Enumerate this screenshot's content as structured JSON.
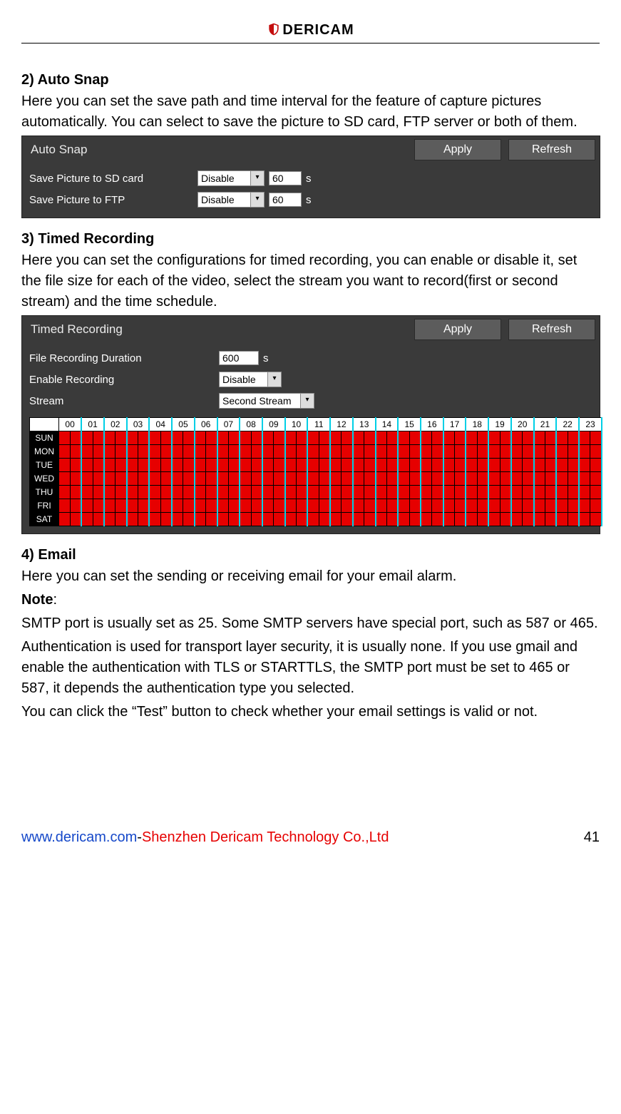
{
  "header": {
    "brand": "DERICAM"
  },
  "sections": {
    "autosnap": {
      "heading": "2) Auto Snap",
      "desc": "Here you can set the save path and time interval for the feature of capture pictures automatically. You can select to save the picture to SD card, FTP server or both of them.",
      "panel_title": "Auto Snap",
      "apply": "Apply",
      "refresh": "Refresh",
      "row1_label": "Save Picture to SD card",
      "row1_select": "Disable",
      "row1_value": "60",
      "row1_unit": "s",
      "row2_label": "Save Picture to FTP",
      "row2_select": "Disable",
      "row2_value": "60",
      "row2_unit": "s"
    },
    "timed": {
      "heading": "3) Timed Recording",
      "desc": "Here you can set the configurations for timed recording, you can enable or disable it, set the file size for each of the video, select the stream you want to record(first or second stream) and the time schedule.",
      "panel_title": "Timed Recording",
      "apply": "Apply",
      "refresh": "Refresh",
      "row1_label": "File Recording Duration",
      "row1_value": "600",
      "row1_unit": "s",
      "row2_label": "Enable Recording",
      "row2_select": "Disable",
      "row3_label": "Stream",
      "row3_select": "Second Stream",
      "hours": [
        "00",
        "01",
        "02",
        "03",
        "04",
        "05",
        "06",
        "07",
        "08",
        "09",
        "10",
        "11",
        "12",
        "13",
        "14",
        "15",
        "16",
        "17",
        "18",
        "19",
        "20",
        "21",
        "22",
        "23"
      ],
      "days": [
        "SUN",
        "MON",
        "TUE",
        "WED",
        "THU",
        "FRI",
        "SAT"
      ]
    },
    "email": {
      "heading": "4) Email",
      "p1": "Here you can set the sending or receiving email for your email alarm.",
      "note_label": "Note",
      "p2": "SMTP port is usually set as 25. Some SMTP servers have special port, such as 587 or 465.",
      "p3": "Authentication is used for transport layer security, it is usually none. If you use gmail and enable the authentication with TLS or STARTTLS, the SMTP port must be set to 465 or 587, it depends the authentication type you selected.",
      "p4": "You can click the “Test” button to check whether your email settings is valid or not."
    }
  },
  "footer": {
    "url": "www.dericam.com",
    "sep": "-",
    "company": "Shenzhen Dericam Technology Co.,Ltd",
    "page": "41"
  }
}
